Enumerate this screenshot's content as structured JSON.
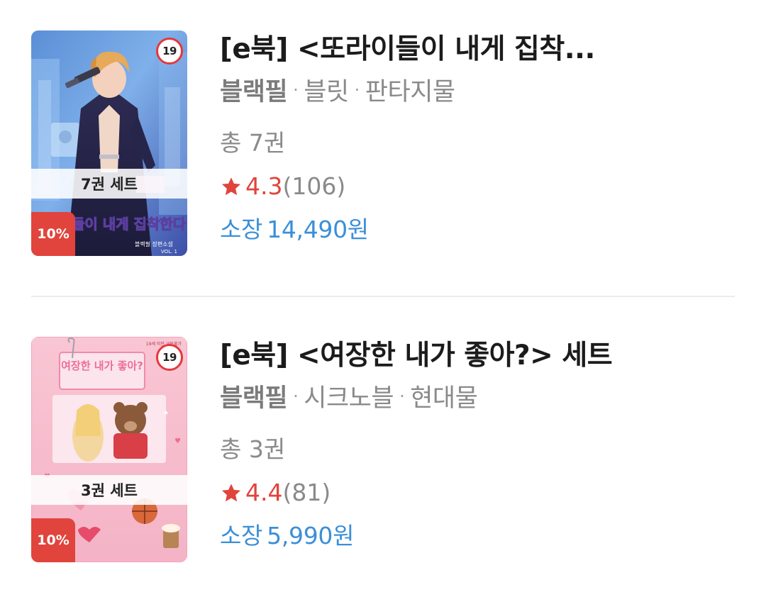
{
  "books": [
    {
      "title": "[e북] <또라이들이 내게 집착...",
      "author": "블랙필",
      "publisher": "블릿",
      "genre": "판타지물",
      "volumes": "총 7권",
      "rating": "4.3",
      "review_count": "(106)",
      "price_label": "소장",
      "price": "14,490원",
      "age_badge": "19",
      "set_label": "7권 세트",
      "discount": "10%",
      "cover_title_art": "또라이들이 내게 집착한다",
      "cover_sub_art": "블랙필 장편소설",
      "cover_vol_art": "VOL. 1"
    },
    {
      "title": "[e북] <여장한 내가 좋아?> 세트",
      "author": "블랙필",
      "publisher": "시크노블",
      "genre": "현대물",
      "volumes": "총 3권",
      "rating": "4.4",
      "review_count": "(81)",
      "price_label": "소장",
      "price": "5,990원",
      "age_badge": "19",
      "set_label": "3권 세트",
      "discount": "10%",
      "cover_title_art": "여장한 내가 좋아?",
      "cover_corner_art": "19세 미만 구독불가"
    }
  ],
  "colors": {
    "rating_red": "#e0443c",
    "price_blue": "#3b8fd8",
    "discount_red": "#e0443c",
    "meta_gray": "#8a8a8a",
    "title_black": "#1b1b1b"
  },
  "icons": {
    "star": "star-icon"
  }
}
